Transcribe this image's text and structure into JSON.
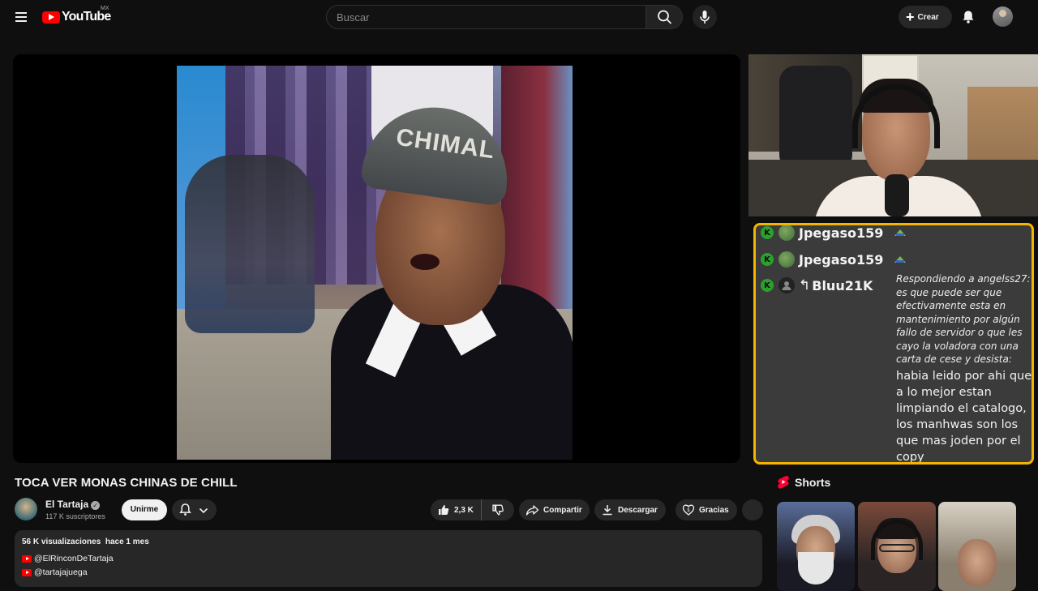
{
  "header": {
    "logo_text": "YouTube",
    "region": "MX",
    "search_placeholder": "Buscar",
    "create_label": "Crear"
  },
  "player": {
    "cap_text": "CHIMAL"
  },
  "chat": {
    "messages": [
      {
        "user": "Jpegaso159",
        "badge": "K"
      },
      {
        "user": "Jpegaso159",
        "badge": "K"
      },
      {
        "user": "Bluu21K",
        "badge": "K",
        "reply_to": "Respondiendo a angelss27: es que puede ser que efectivamente esta en mantenimiento por algún fallo de servidor o que les cayo la voladora con una carta de cese y desista:",
        "text": "habia leido por ahi que a lo mejor estan limpiando el catalogo, los manhwas son los que mas joden por el copy"
      }
    ]
  },
  "video": {
    "title": "TOCA VER MONAS CHINAS DE CHILL",
    "channel": "El Tartaja",
    "subscribers": "117 K suscriptores",
    "join_label": "Unirme",
    "likes": "2,3 K",
    "share_label": "Compartir",
    "download_label": "Descargar",
    "thanks_label": "Gracias"
  },
  "description": {
    "views": "56 K visualizaciones",
    "date": "hace 1 mes",
    "links": [
      "@ElRinconDeTartaja",
      "@tartajajuega"
    ]
  },
  "shorts": {
    "title": "Shorts"
  },
  "colors": {
    "chat_border": "#f5b400",
    "brand_red": "#ff0000",
    "badge_green": "#2ba02b"
  }
}
